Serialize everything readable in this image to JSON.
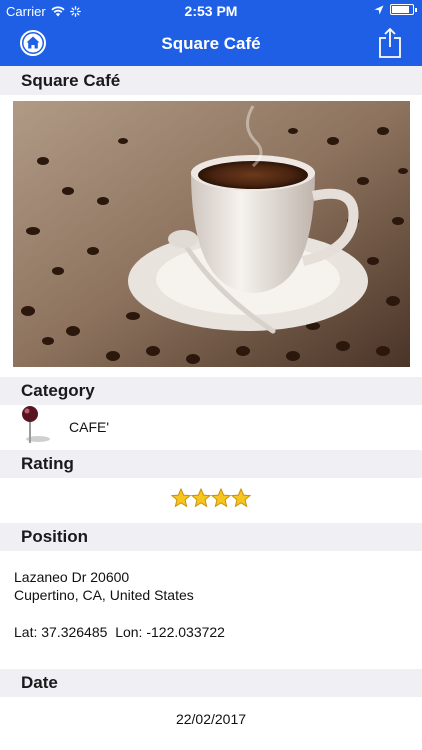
{
  "status_bar": {
    "carrier": "Carrier",
    "time": "2:53 PM",
    "battery_level": 0.9
  },
  "nav": {
    "title": "Square Café",
    "left_icon": "home-icon",
    "right_icon": "share-icon",
    "accent_color": "#1f5fe6"
  },
  "place": {
    "name_header": "Square Café",
    "photo_description_icon": "coffee-photo"
  },
  "category": {
    "header": "Category",
    "value": "CAFE'",
    "icon": "map-pin-icon"
  },
  "rating": {
    "header": "Rating",
    "stars": 4,
    "max_stars": 4
  },
  "position": {
    "header": "Position",
    "address_line1": "Lazaneo Dr 20600",
    "address_line2": "Cupertino, CA, United States",
    "coordinates": "Lat: 37.326485  Lon: -122.033722"
  },
  "date": {
    "header": "Date",
    "value": "22/02/2017"
  }
}
